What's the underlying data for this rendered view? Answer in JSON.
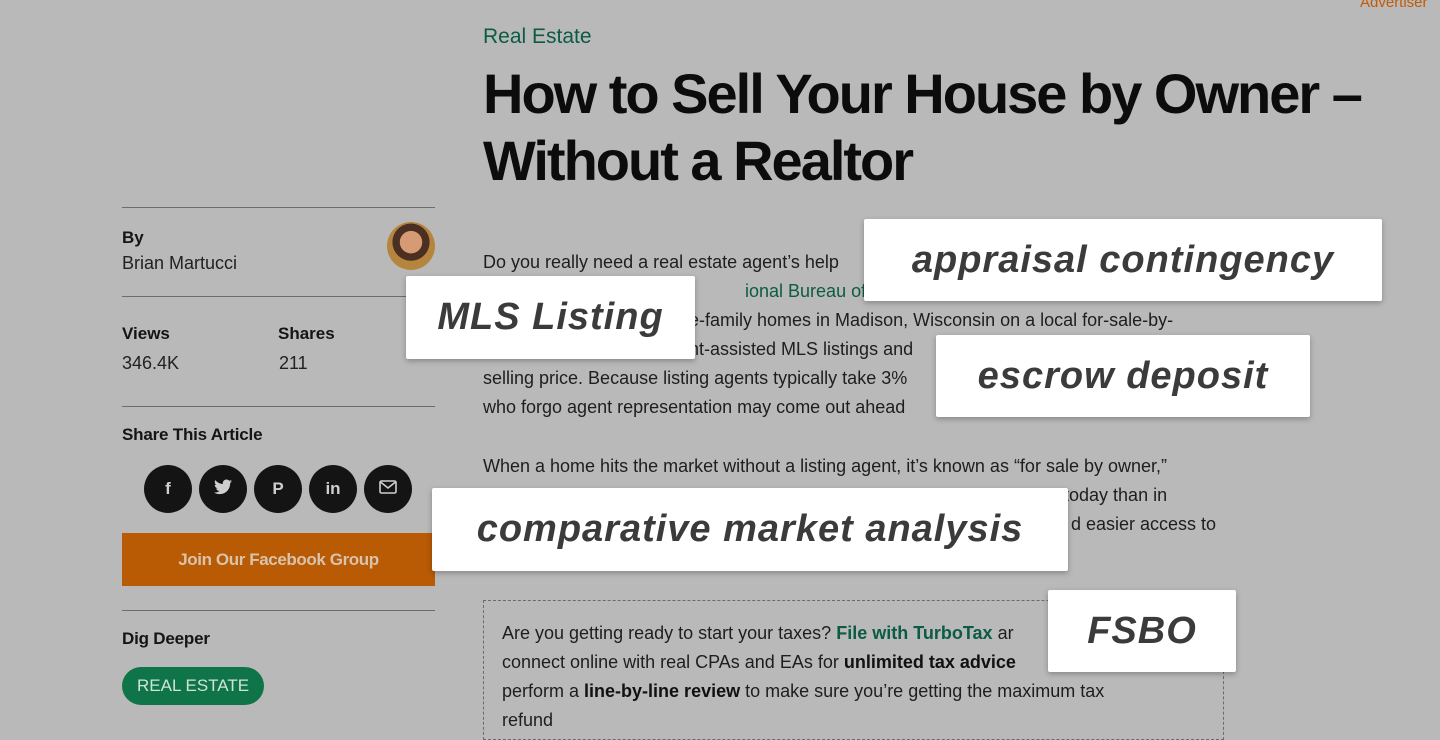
{
  "advertiser_label": "Advertiser",
  "article": {
    "category": "Real Estate",
    "title": "How to Sell Your House by Owner – Without a Realtor",
    "paragraph1": {
      "l1": "Do you really need a real estate agent’s help",
      "l2_link": "ional Bureau of Econ",
      "l3": "e-family homes in Madison, Wisconsin on a local for-sale-by-",
      "l4": "nt-assisted MLS listings and",
      "l5": "selling price. Because listing agents typically take 3%",
      "l6": "who forgo agent representation may come out ahead"
    },
    "paragraph2": {
      "l1": "When a home hits the market without a listing agent, it’s known as “for sale by owner,”",
      "l2": "n today than in",
      "l3": "d easier access to"
    },
    "promo": {
      "t1": "Are you getting ready to start your taxes?",
      "link": "File with TurboTax",
      "t2": "ar",
      "t3": "connect online with real CPAs and EAs for",
      "bold1": "unlimited tax advice",
      "t4": "perform a",
      "bold2": "line-by-line review",
      "t5": "to make sure you’re getting the maximum tax",
      "t6": "refund"
    }
  },
  "sidebar": {
    "by_label": "By",
    "author": "Brian Martucci",
    "views_label": "Views",
    "views_value": "346.4K",
    "shares_label": "Shares",
    "shares_value": "211",
    "share_title": "Share This Article",
    "social": [
      {
        "icon": "facebook-icon",
        "glyph": "f"
      },
      {
        "icon": "twitter-icon",
        "glyph": "🐦"
      },
      {
        "icon": "pinterest-icon",
        "glyph": "P"
      },
      {
        "icon": "linkedin-icon",
        "glyph": "in"
      },
      {
        "icon": "email-icon",
        "glyph": "✉"
      }
    ],
    "facebook_group_label": "Join Our Facebook Group",
    "dig_deeper_title": "Dig Deeper",
    "tag_label": "REAL ESTATE"
  },
  "terms": [
    "appraisal contingency",
    "MLS Listing",
    "escrow deposit",
    "comparative market analysis",
    "FSBO"
  ],
  "colors": {
    "accent_orange": "#b95a04",
    "link_green": "#0c5b44",
    "tag_green": "#0f7549"
  }
}
